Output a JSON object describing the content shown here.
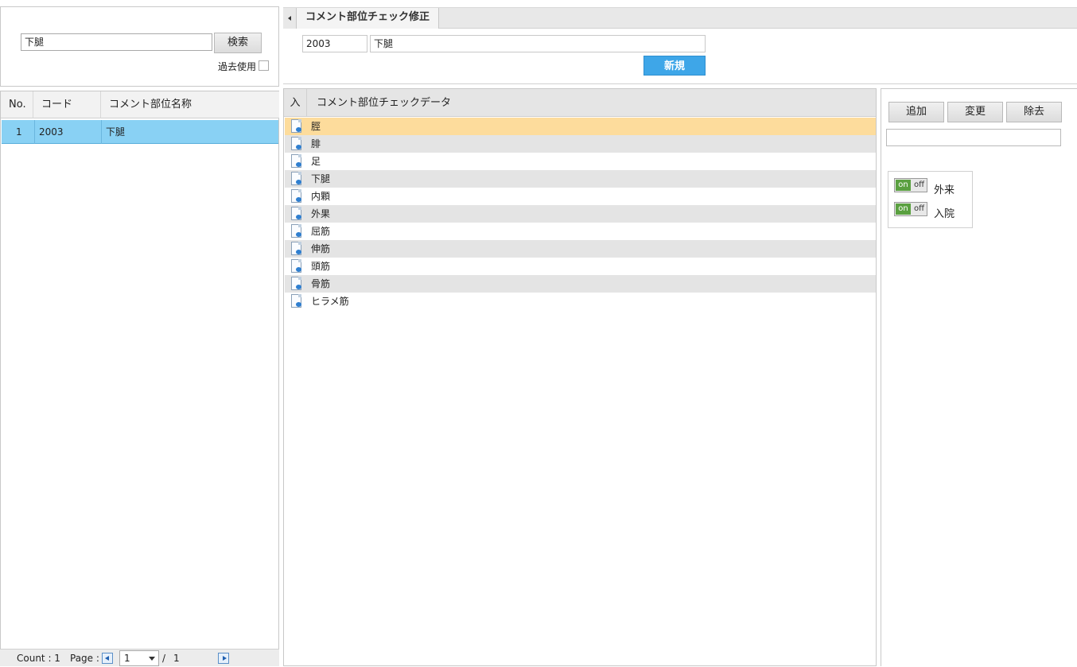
{
  "search": {
    "value": "下腿",
    "button_label": "検索",
    "past_use_label": "過去使用"
  },
  "left_table": {
    "columns": [
      "No.",
      "コード",
      "コメント部位名称"
    ],
    "rows": [
      {
        "no": "1",
        "code": "2003",
        "name": "下腿"
      }
    ]
  },
  "pager": {
    "count_label": "Count : 1",
    "page_label": "Page :",
    "current_page": "1",
    "separator": "/",
    "total_pages": "1"
  },
  "tab": {
    "active_label": "コメント部位チェック修正"
  },
  "form": {
    "code_value": "2003",
    "name_value": "下腿",
    "new_button_label": "新規"
  },
  "data_list": {
    "columns": [
      "入",
      "コメント部位チェックデータ"
    ],
    "rows": [
      "脛",
      "腓",
      "足",
      "下腿",
      "内顆",
      "外果",
      "屈筋",
      "伸筋",
      "頭筋",
      "骨筋",
      "ヒラメ筋"
    ],
    "selected_index": 0
  },
  "right_panel": {
    "add_label": "追加",
    "change_label": "変更",
    "remove_label": "除去",
    "toggles": [
      {
        "on_label": "on",
        "off_label": "off",
        "label": "外来"
      },
      {
        "on_label": "on",
        "off_label": "off",
        "label": "入院"
      }
    ]
  },
  "colors": {
    "selected_left_row": "#89d1f4",
    "selected_data_row": "#fddc9c",
    "striped_row": "#e4e4e4",
    "new_button": "#3ea6e8",
    "toggle_on": "#5aa040"
  }
}
